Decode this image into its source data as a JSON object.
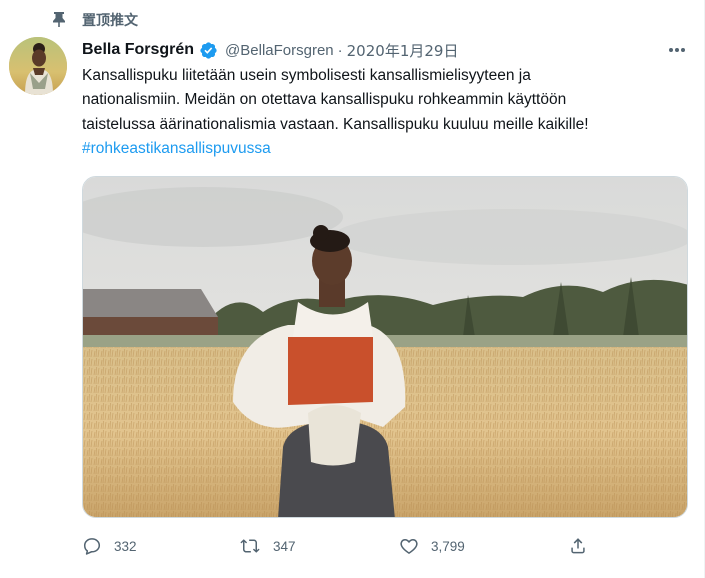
{
  "pinned_label": "置顶推文",
  "author": {
    "display_name": "Bella Forsgrén",
    "handle": "@BellaForsgren",
    "separator": "·",
    "date": "2020年1月29日"
  },
  "tweet": {
    "lines": [
      "Kansallispuku liitetään usein symbolisesti kansallismielisyyteen ja",
      "nationalismiin. Meidän on otettava kansallispuku rohkeammin käyttöön",
      "taistelussa äärinationalismia vastaan. Kansallispuku kuuluu meille kaikille!"
    ],
    "hashtag": "#rohkeastikansallispuvussa"
  },
  "actions": {
    "reply_count": "332",
    "retweet_count": "347",
    "like_count": "3,799"
  },
  "icons": {
    "pin": "pin-icon",
    "verified": "verified-badge-icon",
    "more": "more-options-icon",
    "reply": "reply-icon",
    "retweet": "retweet-icon",
    "like": "heart-icon",
    "share": "share-icon"
  },
  "colors": {
    "accent": "#1d9bf0",
    "secondary_text": "#536471",
    "primary_text": "#0f1419"
  }
}
